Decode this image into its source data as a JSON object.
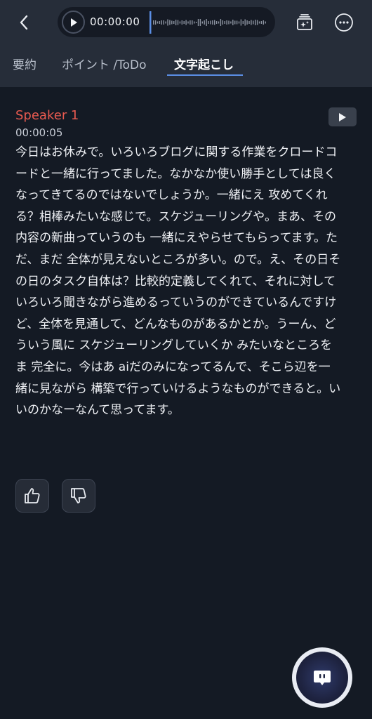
{
  "header": {
    "back_icon": "chevron-left-icon",
    "player": {
      "time": "00:00:00",
      "play_icon": "play-icon",
      "progress": 0
    },
    "icons": [
      "sparkle-card-icon",
      "more-horizontal-icon"
    ]
  },
  "tabs": [
    {
      "label": "要約",
      "active": false
    },
    {
      "label": "ポイント /ToDo",
      "active": false
    },
    {
      "label": "文字起こし",
      "active": true
    }
  ],
  "segment": {
    "speaker": "Speaker 1",
    "timestamp": "00:00:05",
    "speaker_color": "#e85a50",
    "lines": [
      "今日はお休みで。いろいろブログに関する作業をクロードコ",
      "ードと一緒に行ってました。なかなか使い勝手としては良く",
      "なってきてるのではないでしょうか。一緒にえ 攻めてくれ",
      "る？相棒みたいな感じで。スケジューリングや。まあ、その",
      "内容の新曲っていうのも 一緒にえやらせてもらってます。た",
      "だ、まだ 全体が見えないところが多い。ので。え、その日そ",
      "の日のタスク自体は？比較的定義してくれて、それに対して",
      "いろいろ聞きながら進めるっていうのができているんですけ",
      "ど、全体を見通して、どんなものがあるかとか。うーん、ど",
      "ういう風に スケジューリングしていくか みたいなところを",
      "ま 完全に。今はあ aiだのみになってるんで、そこら辺を一",
      "緒に見ながら 構築で行っていけるようなものができると。い",
      "いのかなーなんて思ってます。"
    ]
  },
  "feedback": {
    "like_icon": "thumbs-up-icon",
    "dislike_icon": "thumbs-down-icon"
  },
  "fab": {
    "icon": "chat-bubble-icon"
  },
  "colors": {
    "background": "#141a24",
    "header": "#262d39",
    "accent": "#5b8fe6",
    "speaker": "#e85a50"
  }
}
